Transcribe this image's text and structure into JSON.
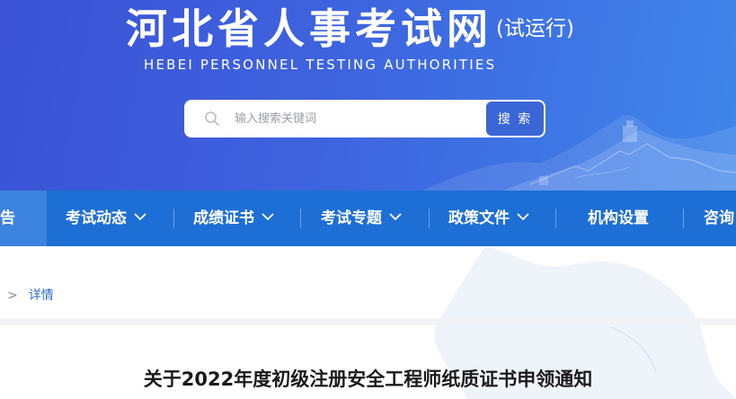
{
  "header": {
    "title": "河北省人事考试网",
    "subtitle": "(试运行)",
    "english": "HEBEI PERSONNEL TESTING AUTHORITIES",
    "search": {
      "placeholder": "输入搜索关键词",
      "button_label": "搜 索"
    }
  },
  "nav": {
    "items": [
      {
        "label": "告",
        "active": true,
        "has_dropdown": false
      },
      {
        "label": "考试动态",
        "has_dropdown": true
      },
      {
        "label": "成绩证书",
        "has_dropdown": true
      },
      {
        "label": "考试专题",
        "has_dropdown": true
      },
      {
        "label": "政策文件",
        "has_dropdown": true
      },
      {
        "label": "机构设置",
        "has_dropdown": false
      },
      {
        "label": "咨询",
        "has_dropdown": false
      }
    ]
  },
  "breadcrumb": {
    "separator": ">",
    "current": "详情"
  },
  "article": {
    "title": "关于2022年度初级注册安全工程师纸质证书申领通知"
  },
  "colors": {
    "banner_start": "#3b52d6",
    "banner_end": "#3f86ea",
    "nav_bg": "#1d6fd6",
    "nav_active": "#3b83df",
    "search_button": "#3a66d8",
    "link": "#2b6ed3"
  }
}
